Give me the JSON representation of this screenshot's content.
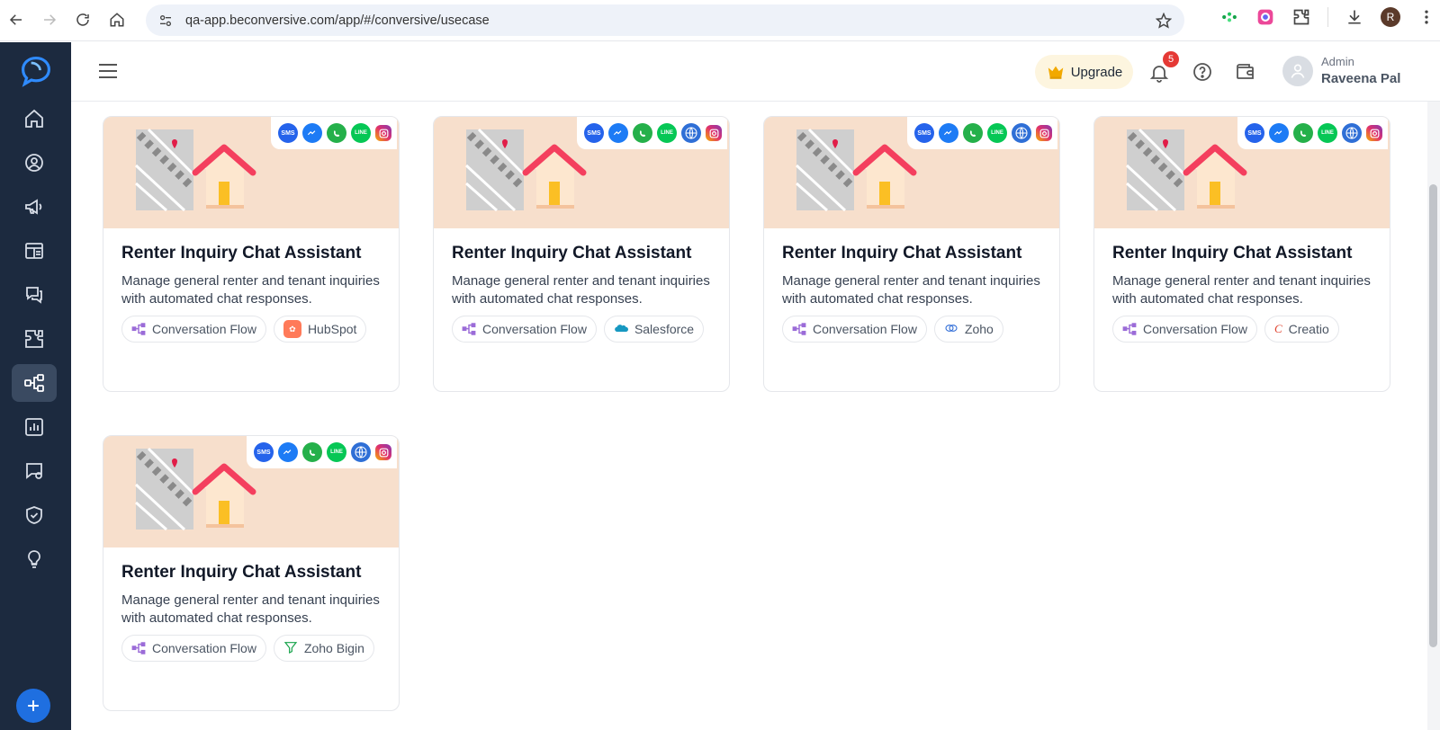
{
  "browser": {
    "url": "qa-app.beconversive.com/app/#/conversive/usecase",
    "profile_initial": "R"
  },
  "header": {
    "upgrade_label": "Upgrade",
    "notification_count": "5",
    "user_role": "Admin",
    "user_name": "Raveena Pal"
  },
  "cards": [
    {
      "title": "Renter Inquiry Chat Assistant",
      "description": "Manage general renter and tenant inquiries with automated chat responses.",
      "flow_tag": "Conversation Flow",
      "crm_tag": "HubSpot",
      "channels": [
        "SMS",
        "Messenger",
        "WhatsApp",
        "LINE",
        "Instagram"
      ]
    },
    {
      "title": "Renter Inquiry Chat Assistant",
      "description": "Manage general renter and tenant inquiries with automated chat responses.",
      "flow_tag": "Conversation Flow",
      "crm_tag": "Salesforce",
      "channels": [
        "SMS",
        "Messenger",
        "WhatsApp",
        "LINE",
        "Web",
        "Instagram"
      ]
    },
    {
      "title": "Renter Inquiry Chat Assistant",
      "description": "Manage general renter and tenant inquiries with automated chat responses.",
      "flow_tag": "Conversation Flow",
      "crm_tag": "Zoho",
      "channels": [
        "SMS",
        "Messenger",
        "WhatsApp",
        "LINE",
        "Web",
        "Instagram"
      ]
    },
    {
      "title": "Renter Inquiry Chat Assistant",
      "description": "Manage general renter and tenant inquiries with automated chat responses.",
      "flow_tag": "Conversation Flow",
      "crm_tag": "Creatio",
      "channels": [
        "SMS",
        "Messenger",
        "WhatsApp",
        "LINE",
        "Web",
        "Instagram"
      ]
    },
    {
      "title": "Renter Inquiry Chat Assistant",
      "description": "Manage general renter and tenant inquiries with automated chat responses.",
      "flow_tag": "Conversation Flow",
      "crm_tag": "Zoho Bigin",
      "channels": [
        "SMS",
        "Messenger",
        "WhatsApp",
        "LINE",
        "Web",
        "Instagram"
      ]
    }
  ],
  "channel_labels": {
    "sms": "SMS",
    "line": "LINE"
  },
  "colors": {
    "sidebar_bg": "#1c2a3f",
    "card_banner": "#f7dfcc",
    "accent_blue": "#1f6fe0",
    "upgrade_bg": "#fdf5df",
    "badge_red": "#e53935"
  }
}
